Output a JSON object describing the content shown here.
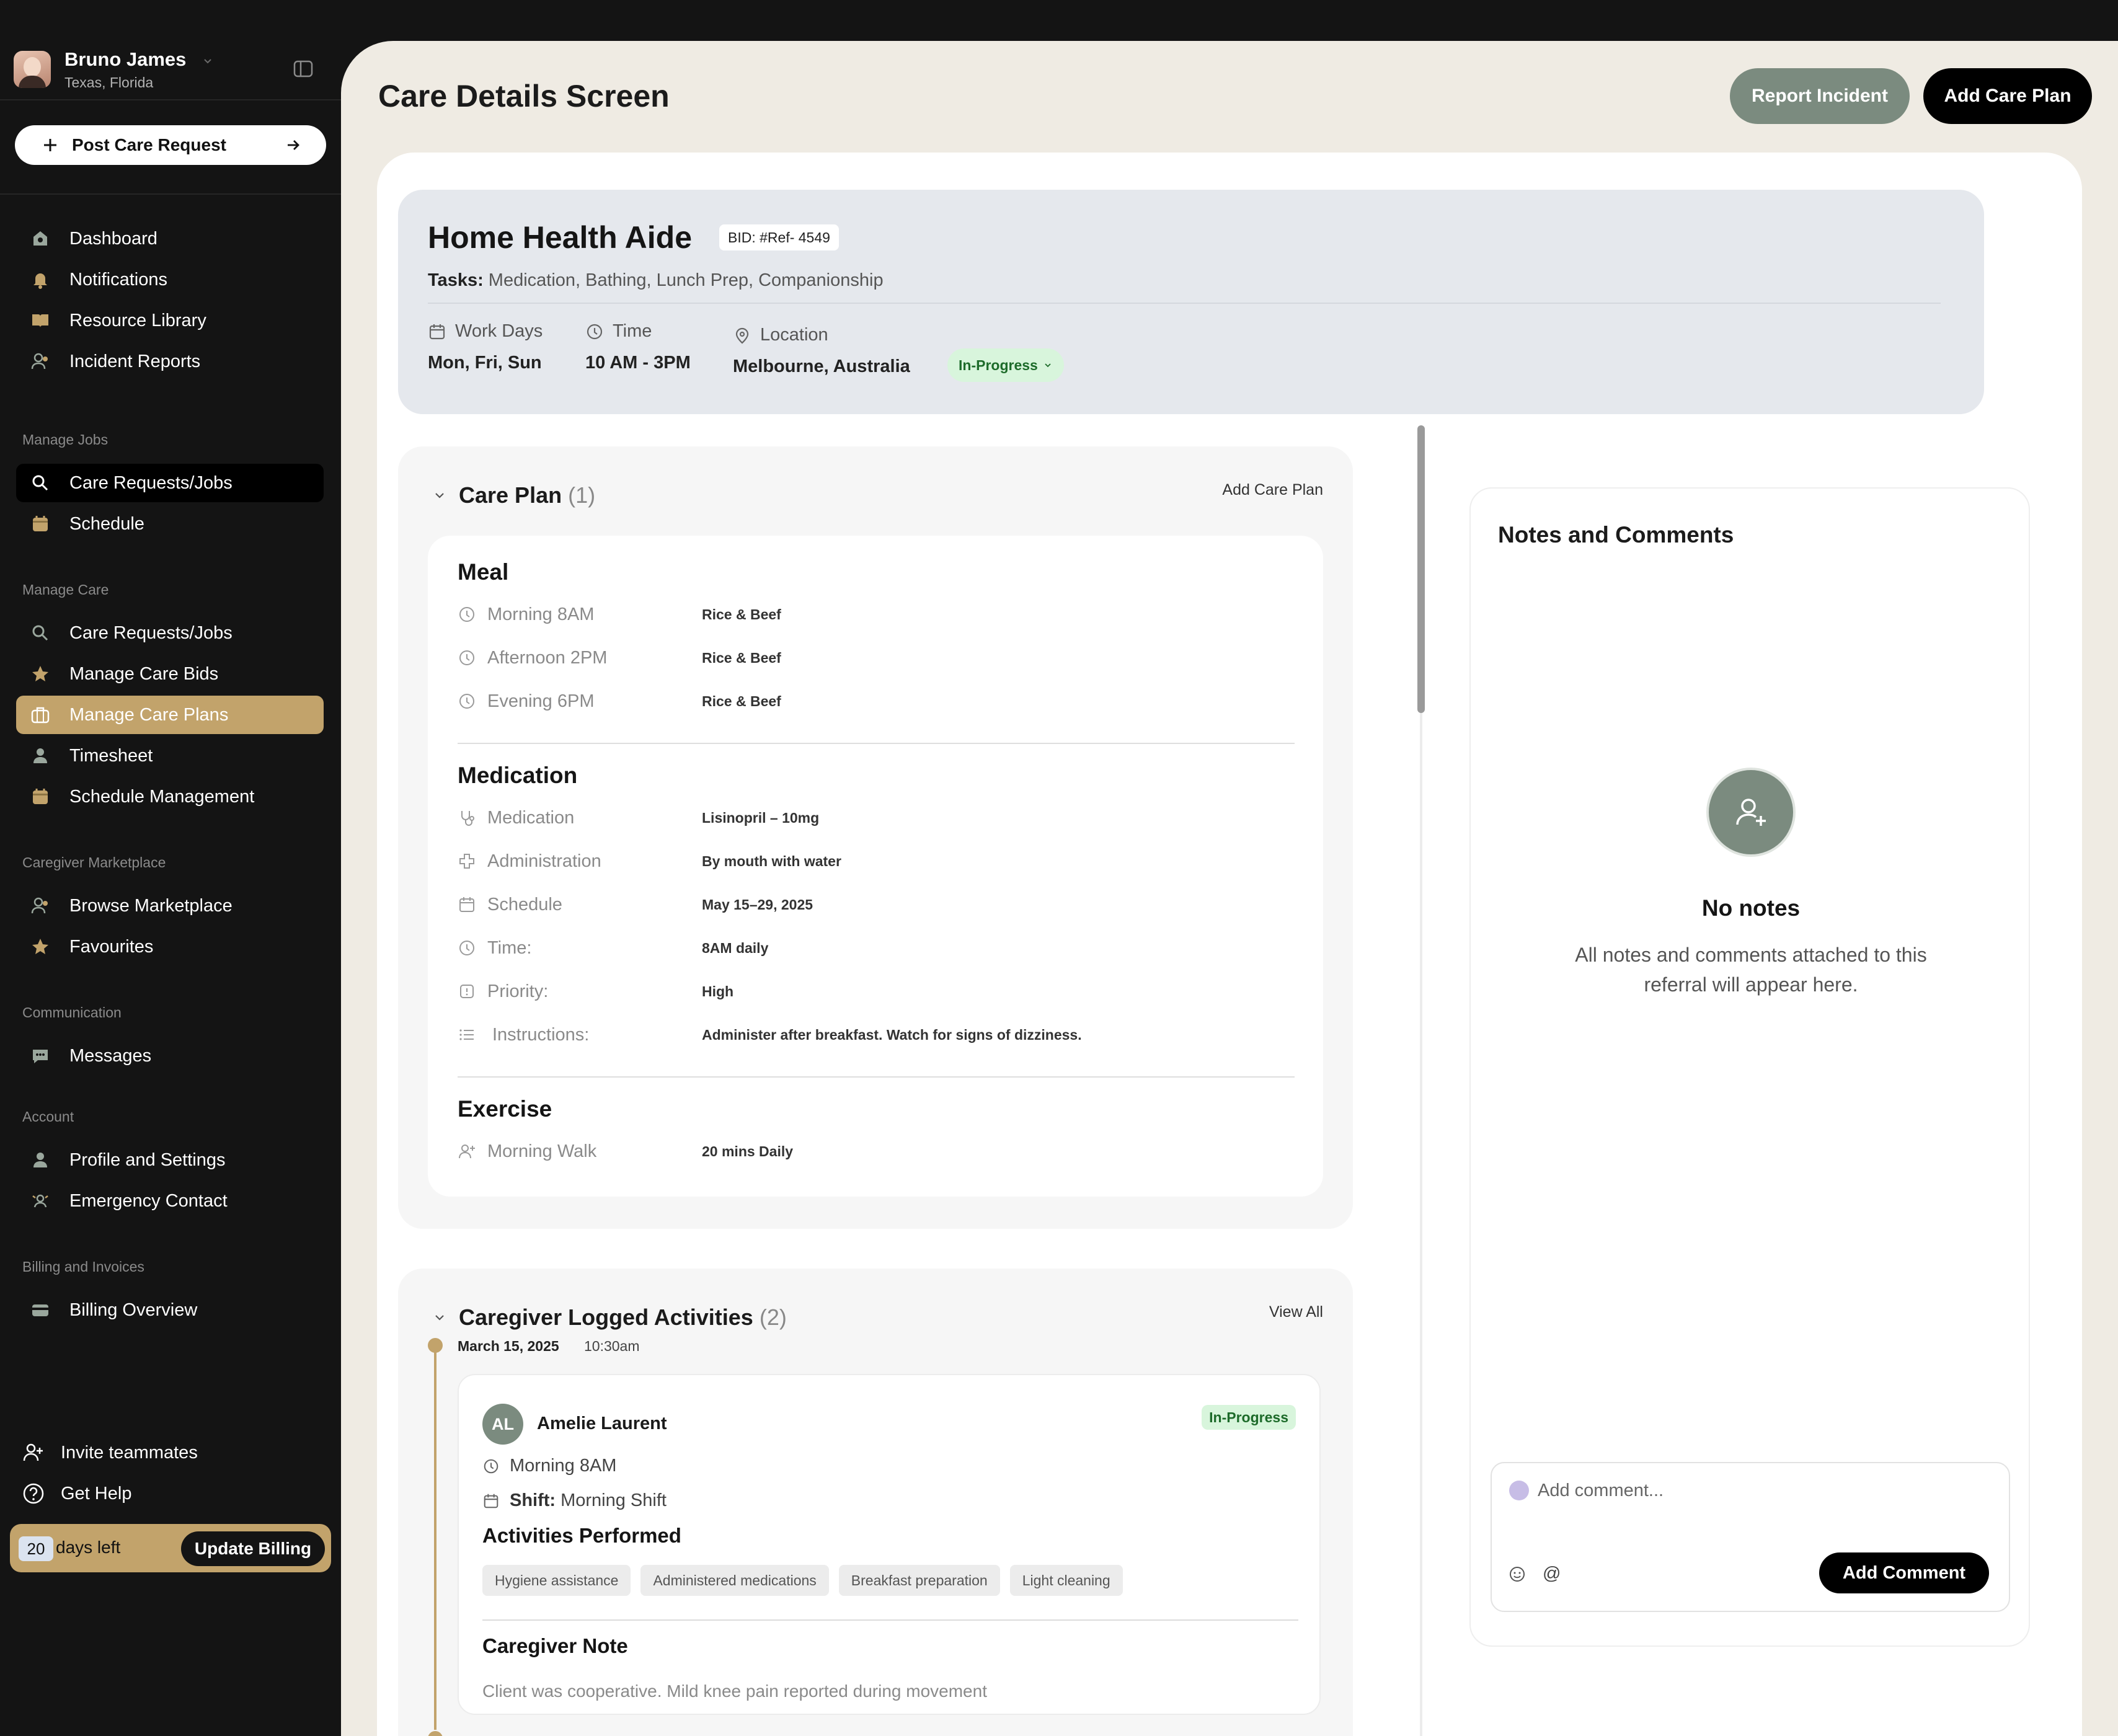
{
  "user": {
    "name": "Bruno James",
    "location": "Texas, Florida"
  },
  "post_request": {
    "label": "Post Care Request"
  },
  "nav_main": [
    {
      "label": "Dashboard",
      "icon": "home-icon"
    },
    {
      "label": "Notifications",
      "icon": "bell-icon"
    },
    {
      "label": "Resource Library",
      "icon": "book-icon"
    },
    {
      "label": "Incident Reports",
      "icon": "users-icon"
    }
  ],
  "sections": {
    "manage_jobs": "Manage Jobs",
    "manage_care": "Manage Care",
    "marketplace": "Caregiver Marketplace",
    "communication": "Communication",
    "account": "Account",
    "billing": "Billing and Invoices"
  },
  "nav_jobs": [
    {
      "label": "Care Requests/Jobs",
      "icon": "search-icon",
      "active": true
    },
    {
      "label": "Schedule",
      "icon": "calendar-icon"
    }
  ],
  "nav_care": [
    {
      "label": "Care Requests/Jobs",
      "icon": "search-icon"
    },
    {
      "label": "Manage Care Bids",
      "icon": "star-icon"
    },
    {
      "label": "Manage Care Plans",
      "icon": "briefcase-icon",
      "active": true
    },
    {
      "label": "Timesheet",
      "icon": "user-icon"
    },
    {
      "label": "Schedule Management",
      "icon": "calendar-icon"
    }
  ],
  "nav_marketplace": [
    {
      "label": "Browse Marketplace",
      "icon": "users-icon"
    },
    {
      "label": "Favourites",
      "icon": "star-icon"
    }
  ],
  "nav_communication": [
    {
      "label": "Messages",
      "icon": "chat-icon"
    }
  ],
  "nav_account": [
    {
      "label": "Profile and Settings",
      "icon": "user-icon"
    },
    {
      "label": "Emergency Contact",
      "icon": "contact-icon"
    }
  ],
  "nav_billing": [
    {
      "label": "Billing Overview",
      "icon": "card-icon"
    }
  ],
  "bottom": {
    "invite": "Invite teammates",
    "help": "Get Help",
    "days": "20",
    "days_label": "days left",
    "update_billing": "Update Billing"
  },
  "header": {
    "title": "Care Details Screen",
    "report_incident": "Report Incident",
    "add_care_plan": "Add Care Plan"
  },
  "job": {
    "title": "Home Health Aide",
    "bid": "BID: #Ref- 4549",
    "tasks_label": "Tasks:",
    "tasks": "Medication, Bathing, Lunch Prep, Companionship",
    "work_days_label": "Work Days",
    "work_days": "Mon, Fri, Sun",
    "time_label": "Time",
    "time": "10 AM - 3PM",
    "location_label": "Location",
    "location": "Melbourne, Australia",
    "status": "In-Progress"
  },
  "care_plan": {
    "title": "Care Plan",
    "count": "(1)",
    "add_link": "Add Care Plan",
    "meal": {
      "title": "Meal",
      "rows": [
        {
          "label": "Morning 8AM",
          "value": "Rice & Beef"
        },
        {
          "label": "Afternoon 2PM",
          "value": "Rice & Beef"
        },
        {
          "label": "Evening 6PM",
          "value": "Rice & Beef"
        }
      ]
    },
    "medication": {
      "title": "Medication",
      "rows": [
        {
          "label": "Medication",
          "value": "Lisinopril – 10mg",
          "icon": "stethoscope-icon"
        },
        {
          "label": "Administration",
          "value": "By mouth with water",
          "icon": "medical-cross-icon"
        },
        {
          "label": "Schedule",
          "value": " May 15–29, 2025",
          "icon": "calendar-icon"
        },
        {
          "label": "Time:",
          "value": "8AM daily",
          "icon": "clock-icon"
        },
        {
          "label": "Priority:",
          "value": "High",
          "icon": "priority-icon"
        },
        {
          "label": "Instructions:",
          "value": "Administer after breakfast. Watch for signs of dizziness.",
          "icon": "list-icon"
        }
      ]
    },
    "exercise": {
      "title": "Exercise",
      "rows": [
        {
          "label": "Morning Walk",
          "value": "20 mins Daily"
        }
      ]
    }
  },
  "activities": {
    "title": "Caregiver Logged Activities",
    "count": "(2)",
    "view_all": "View All",
    "date": "March 15, 2025",
    "time": "10:30am",
    "entry": {
      "initials": "AL",
      "name": "Amelie Laurent",
      "status": "In-Progress",
      "slot": "Morning 8AM",
      "shift_label": "Shift:",
      "shift": "Morning Shift",
      "performed_title": "Activities Performed",
      "chips": [
        "Hygiene assistance",
        "Administered medications",
        "Breakfast preparation",
        "Light cleaning"
      ],
      "note_title": "Caregiver Note",
      "note": "Client was cooperative. Mild knee pain reported during movement"
    }
  },
  "notes": {
    "title": "Notes and Comments",
    "empty_title": "No notes",
    "empty_desc": "All notes and comments attached to this referral will appear here.",
    "placeholder": "Add comment...",
    "at": "@",
    "add_comment": "Add Comment"
  }
}
